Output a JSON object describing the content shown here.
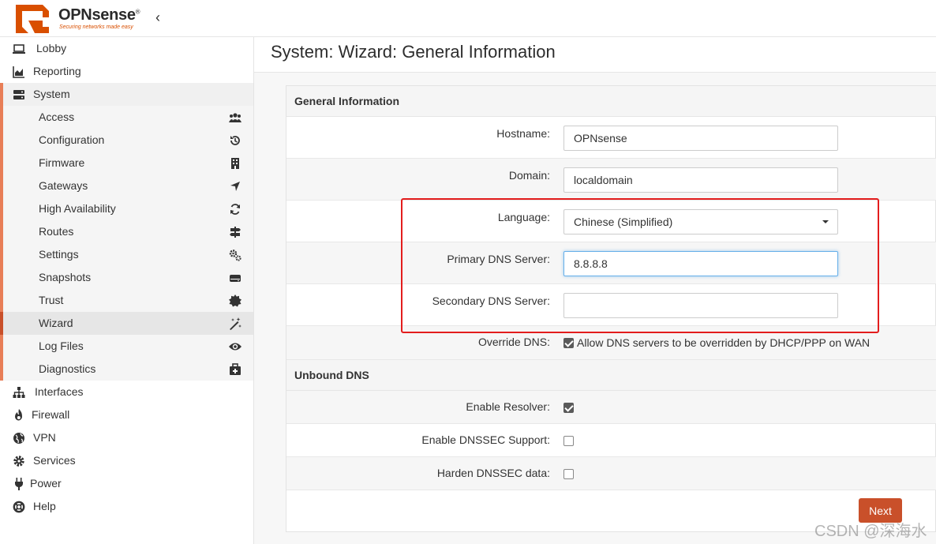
{
  "header": {
    "brand": "OPNsense",
    "reg_mark": "®",
    "tagline": "Securing networks made easy",
    "collapse_icon": "chevron-left-icon"
  },
  "sidebar": {
    "top_items": [
      {
        "label": "Lobby",
        "icon": "laptop-icon"
      },
      {
        "label": "Reporting",
        "icon": "area-chart-icon"
      }
    ],
    "system": {
      "label": "System",
      "icon": "server-icon"
    },
    "system_items": [
      {
        "label": "Access",
        "icon": "users-icon"
      },
      {
        "label": "Configuration",
        "icon": "history-icon"
      },
      {
        "label": "Firmware",
        "icon": "building-icon"
      },
      {
        "label": "Gateways",
        "icon": "location-arrow-icon"
      },
      {
        "label": "High Availability",
        "icon": "refresh-icon"
      },
      {
        "label": "Routes",
        "icon": "signpost-icon"
      },
      {
        "label": "Settings",
        "icon": "cogs-icon"
      },
      {
        "label": "Snapshots",
        "icon": "hdd-icon"
      },
      {
        "label": "Trust",
        "icon": "certificate-icon"
      },
      {
        "label": "Wizard",
        "icon": "magic-icon"
      },
      {
        "label": "Log Files",
        "icon": "eye-icon"
      },
      {
        "label": "Diagnostics",
        "icon": "medkit-icon"
      }
    ],
    "bottom_items": [
      {
        "label": "Interfaces",
        "icon": "sitemap-icon"
      },
      {
        "label": "Firewall",
        "icon": "fire-icon"
      },
      {
        "label": "VPN",
        "icon": "globe-icon"
      },
      {
        "label": "Services",
        "icon": "cog-icon"
      },
      {
        "label": "Power",
        "icon": "plug-icon"
      },
      {
        "label": "Help",
        "icon": "life-ring-icon"
      }
    ]
  },
  "main": {
    "title": "System: Wizard: General Information",
    "general_section": "General Information",
    "hostname_label": "Hostname:",
    "hostname_value": "OPNsense",
    "domain_label": "Domain:",
    "domain_value": "localdomain",
    "language_label": "Language:",
    "language_value": "Chinese (Simplified)",
    "primary_dns_label": "Primary DNS Server:",
    "primary_dns_value": "8.8.8.8",
    "secondary_dns_label": "Secondary DNS Server:",
    "secondary_dns_value": "",
    "override_label": "Override DNS:",
    "override_text": "Allow DNS servers to be overridden by DHCP/PPP on WAN",
    "override_checked": true,
    "unbound_section": "Unbound DNS",
    "enable_resolver_label": "Enable Resolver:",
    "enable_resolver_checked": true,
    "dnssec_label": "Enable DNSSEC Support:",
    "dnssec_checked": false,
    "harden_label": "Harden DNSSEC data:",
    "harden_checked": false,
    "next_label": "Next"
  },
  "watermark": "CSDN @深海水",
  "colors": {
    "accent": "#c9502a",
    "sidebar_marker": "#e87e57",
    "highlight_box": "#e31d1d"
  }
}
